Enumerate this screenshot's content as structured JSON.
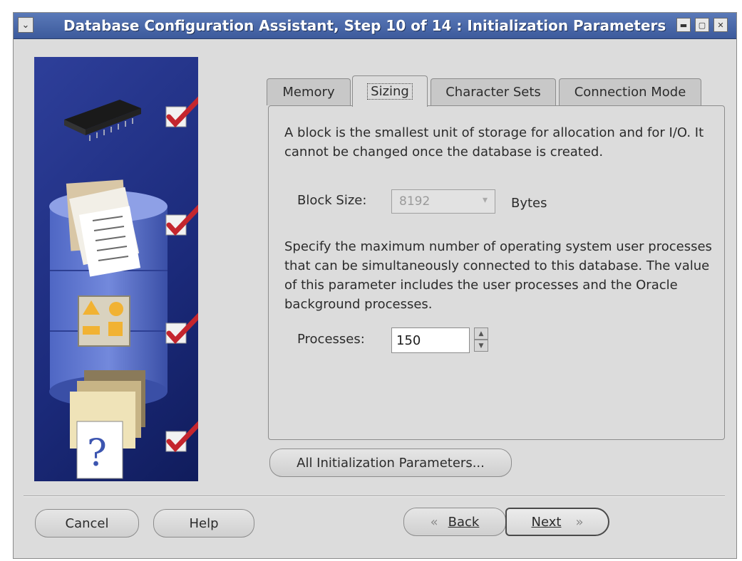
{
  "window": {
    "title": "Database Configuration Assistant, Step 10 of 14 : Initialization Parameters",
    "sysmenu_glyph": "⌄"
  },
  "tabs": [
    {
      "label": "Memory",
      "active": false
    },
    {
      "label": "Sizing",
      "active": true
    },
    {
      "label": "Character Sets",
      "active": false
    },
    {
      "label": "Connection Mode",
      "active": false
    }
  ],
  "sizing": {
    "block_description": "A block is the smallest unit of storage for allocation and for I/O. It cannot be changed once the database is created.",
    "block_size_label": "Block Size:",
    "block_size_value": "8192",
    "block_size_unit": "Bytes",
    "processes_description": "Specify the maximum number of operating system user processes that can be simultaneously connected to this database. The value of this parameter includes the user processes and the Oracle background processes.",
    "processes_label": "Processes:",
    "processes_value": "150"
  },
  "buttons": {
    "all_params": "All Initialization Parameters...",
    "cancel": "Cancel",
    "help": "Help",
    "back": "Back",
    "next": "Next"
  },
  "icons": {
    "chip": "memory-chip-icon",
    "documents": "documents-icon",
    "shapes": "shapes-icon",
    "folders": "folders-question-icon",
    "check": "checkmark-icon"
  },
  "colors": {
    "title_bar": "#3c5a9c",
    "sidebar": "#1b2a7a",
    "check": "#c4262e"
  }
}
